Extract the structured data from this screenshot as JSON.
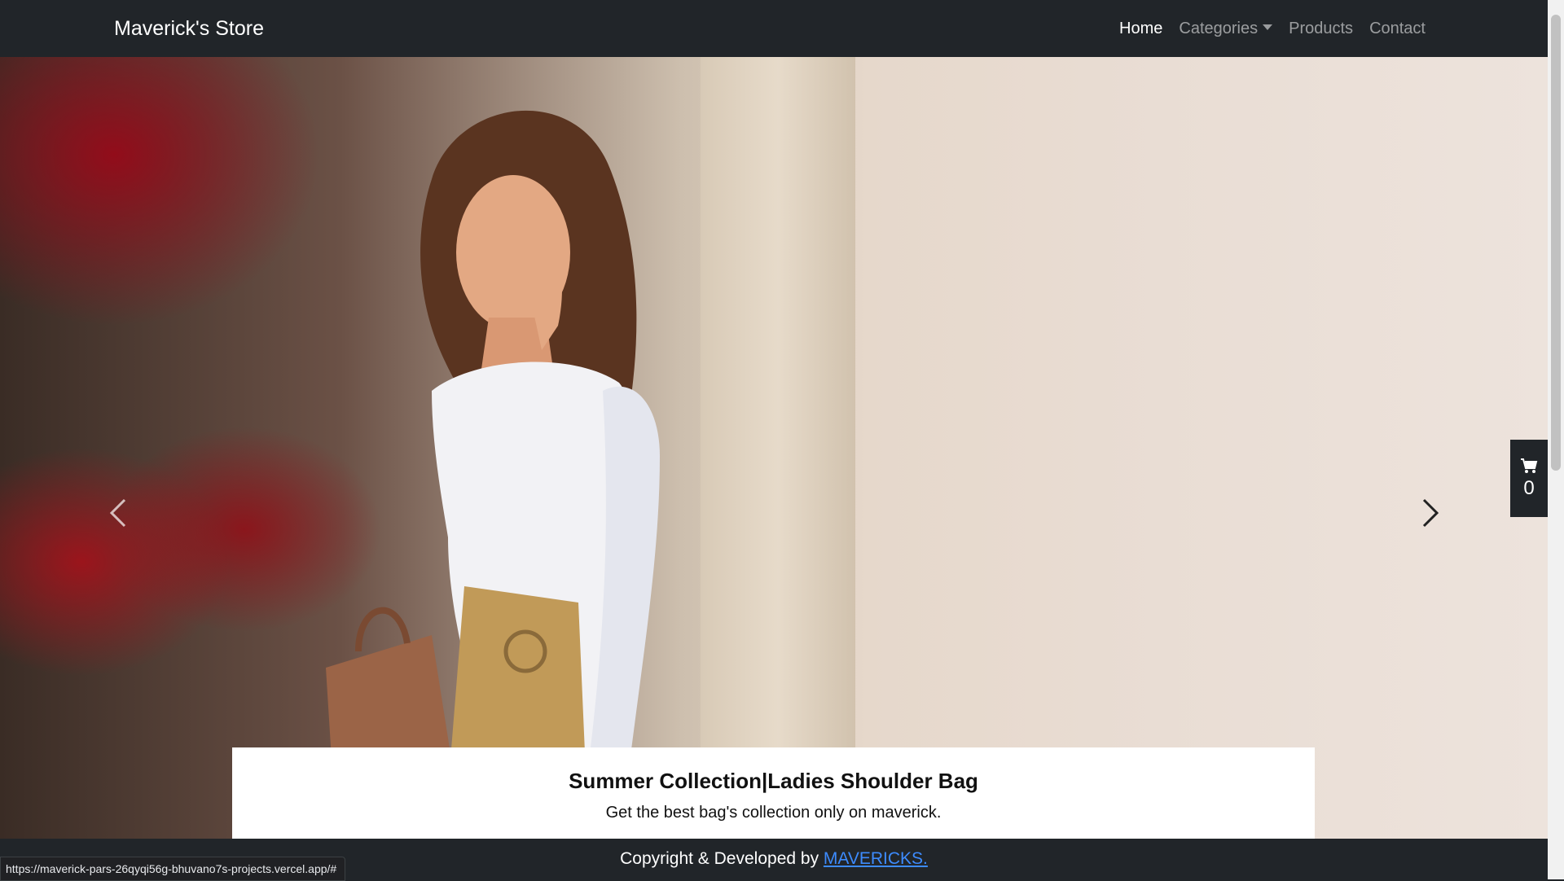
{
  "navbar": {
    "brand": "Maverick's Store",
    "links": [
      {
        "label": "Home",
        "active": true
      },
      {
        "label": "Categories",
        "dropdown": true
      },
      {
        "label": "Products"
      },
      {
        "label": "Contact"
      }
    ]
  },
  "carousel": {
    "caption_title": "Summer Collection|Ladies Shoulder Bag",
    "caption_text": "Get the best bag's collection only on maverick.",
    "prev_icon": "chevron-left-icon",
    "next_icon": "chevron-right-icon"
  },
  "cart": {
    "icon": "cart-icon",
    "count": "0"
  },
  "footer": {
    "text": "Copyright & Developed by",
    "link_text": "MAVERICKS."
  },
  "status_bar": {
    "url": "https://maverick-pars-26qyqi56g-bhuvano7s-projects.vercel.app/#"
  }
}
